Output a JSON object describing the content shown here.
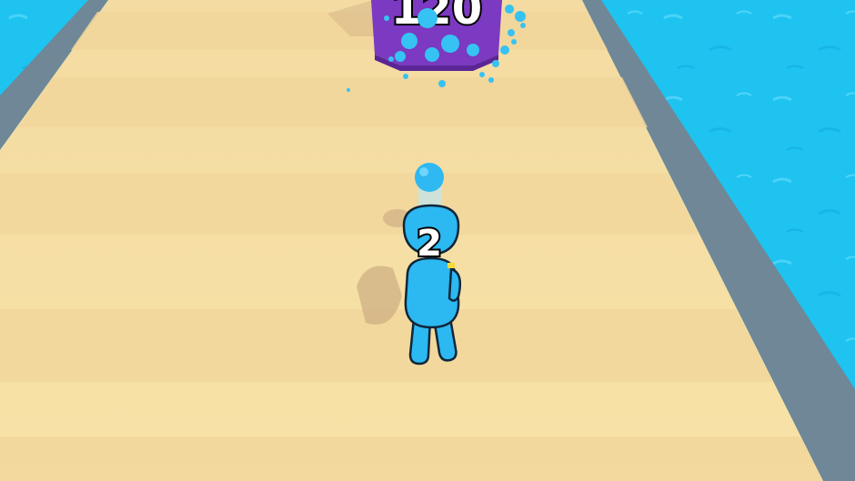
{
  "game": {
    "target_block": {
      "number": "120"
    },
    "player": {
      "count_label": "2"
    }
  },
  "colors": {
    "water": "#1ec3f0",
    "track_sand": "#f6dea0",
    "track_rail": "#6f8797",
    "block_purple": "#7c39c1",
    "player_blue": "#2cb8f1",
    "outline": "#10263a"
  }
}
